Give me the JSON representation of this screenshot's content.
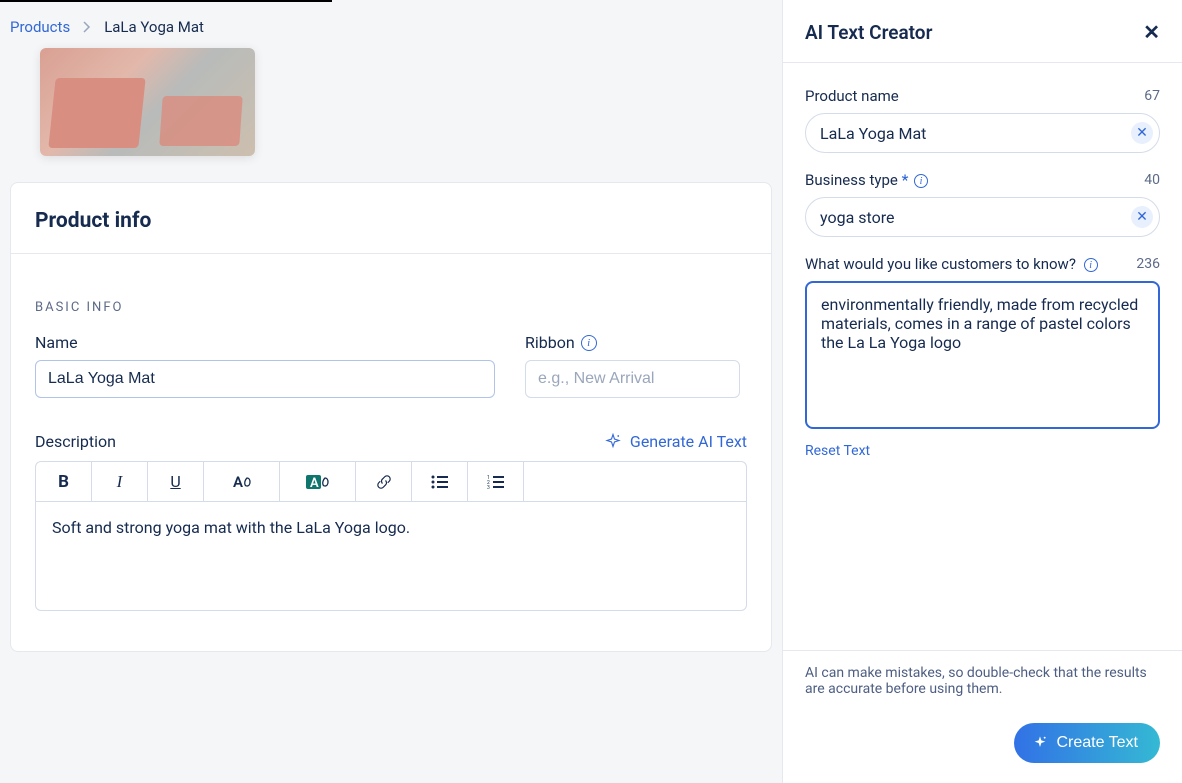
{
  "breadcrumb": {
    "root": "Products",
    "current": "LaLa Yoga Mat"
  },
  "card": {
    "title": "Product info",
    "section": "BASIC INFO",
    "name_label": "Name",
    "name_value": "LaLa Yoga Mat",
    "ribbon_label": "Ribbon",
    "ribbon_placeholder": "e.g., New Arrival",
    "description_label": "Description",
    "generate_label": "Generate AI Text",
    "description_value": "Soft and strong yoga mat with the LaLa Yoga logo."
  },
  "panel": {
    "title": "AI Text Creator",
    "product_name_label": "Product name",
    "product_name_count": "67",
    "product_name_value": "LaLa Yoga Mat",
    "business_label": "Business type",
    "business_count": "40",
    "business_value": "yoga store",
    "know_label": "What would you like customers to know?",
    "know_count": "236",
    "know_value": "environmentally friendly, made from recycled materials, comes in a range of pastel colors  the La La Yoga logo",
    "reset": "Reset Text",
    "disclaimer": "AI can make mistakes, so double-check that the results are accurate before using them.",
    "create": "Create Text"
  }
}
